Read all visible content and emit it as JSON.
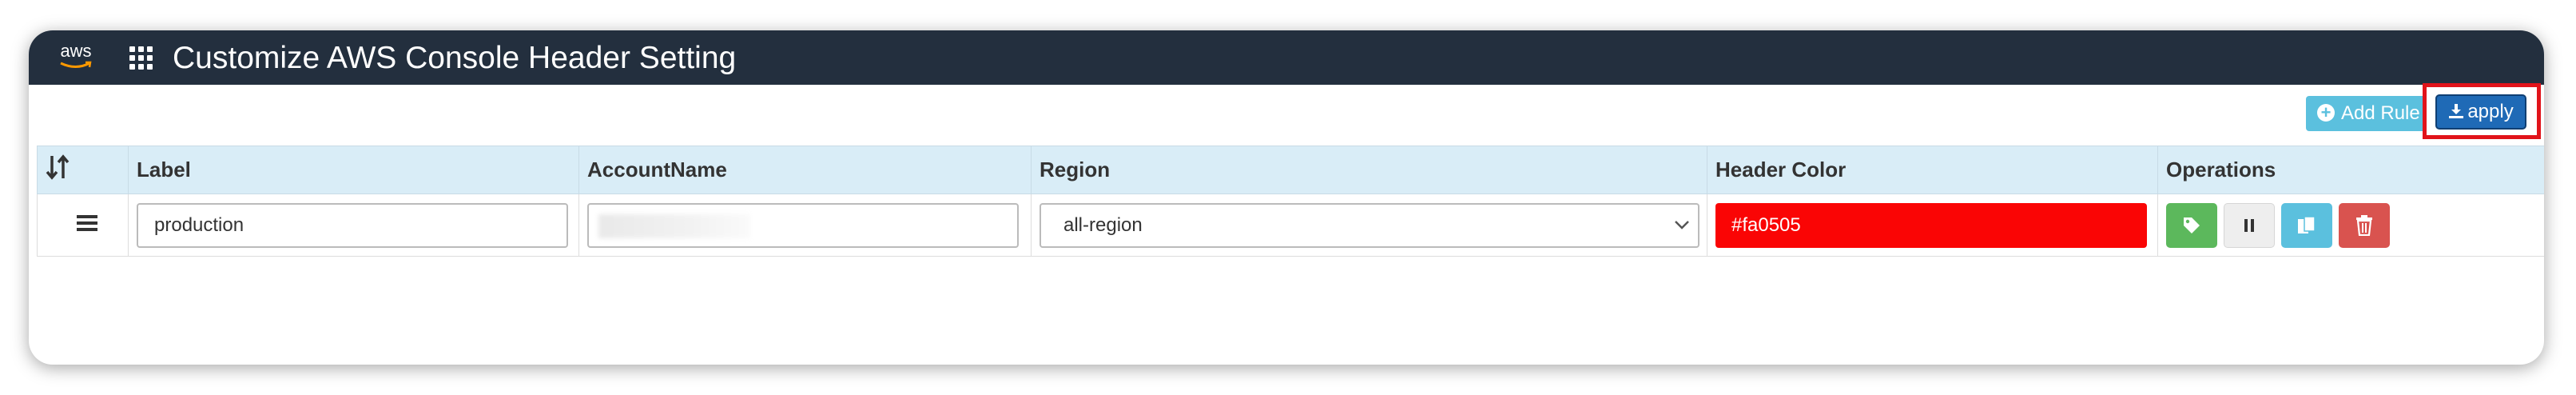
{
  "header": {
    "logo_text": "aws",
    "title": "Customize AWS Console Header Setting"
  },
  "toolbar": {
    "add_rule_label": "Add Rule",
    "apply_label": "apply"
  },
  "table": {
    "columns": [
      "Label",
      "AccountName",
      "Region",
      "Header Color",
      "Operations"
    ],
    "rows": [
      {
        "label": "production",
        "account_name": "",
        "region": "all-region",
        "header_color": "#fa0505"
      }
    ]
  },
  "colors": {
    "header_bg": "#232f3e",
    "table_header_bg": "#d9edf7",
    "header_color_swatch": "#fa0505",
    "highlight_border": "#e1131a"
  },
  "icons": {
    "sort": "sort-icon",
    "drag": "drag-handle-icon",
    "grid": "grid-menu-icon",
    "add": "plus-circle-icon",
    "apply": "download-icon",
    "tag": "tag-icon",
    "pause": "pause-icon",
    "copy": "copy-icon",
    "delete": "trash-icon"
  }
}
